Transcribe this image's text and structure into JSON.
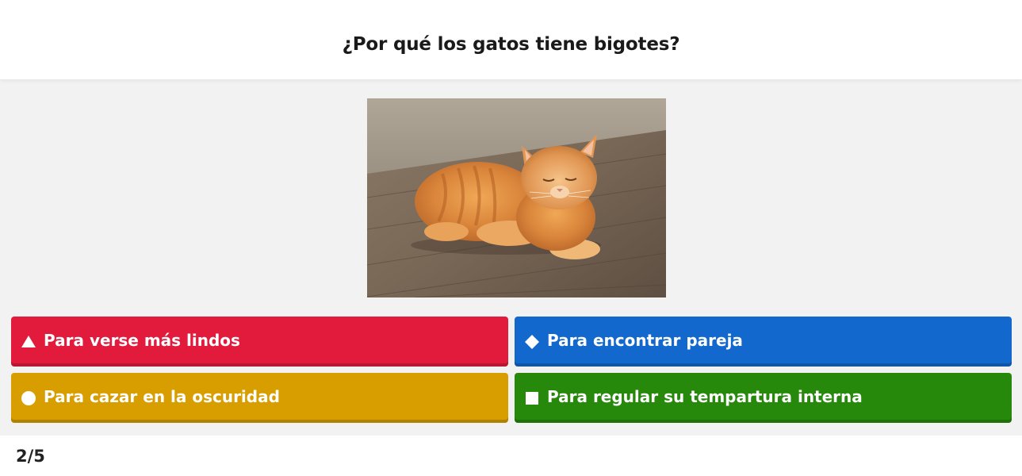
{
  "question": {
    "text": "¿Por qué los gatos tiene bigotes?"
  },
  "media": {
    "description_icon": "cat-photo"
  },
  "answers": [
    {
      "label": "Para verse más lindos",
      "shape": "triangle-icon",
      "color": "#e21b3c"
    },
    {
      "label": "Para encontrar pareja",
      "shape": "diamond-icon",
      "color": "#1368ce"
    },
    {
      "label": "Para cazar en la oscuridad",
      "shape": "circle-icon",
      "color": "#d89e00"
    },
    {
      "label": "Para regular su tempartura interna",
      "shape": "square-icon",
      "color": "#26890c"
    }
  ],
  "footer": {
    "progress": "2/5"
  }
}
